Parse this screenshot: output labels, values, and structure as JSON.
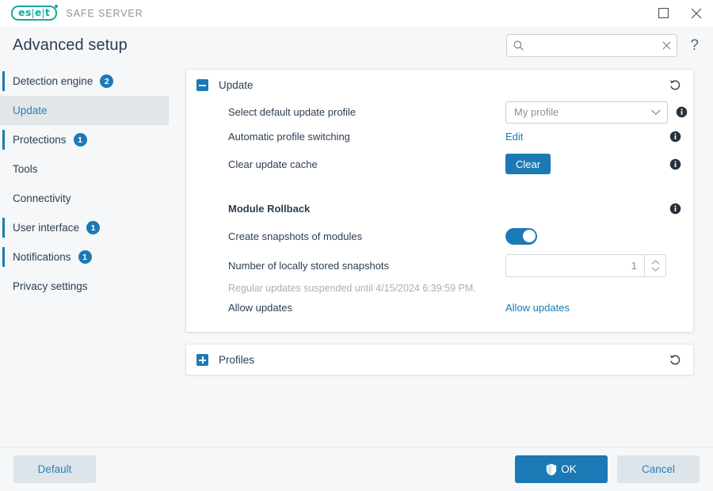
{
  "titlebar": {
    "logo_text_1": "es",
    "logo_text_2": "e",
    "logo_text_3": "t",
    "product_name": "SAFE SERVER",
    "maximize_icon": "maximize-icon",
    "close_icon": "close-icon"
  },
  "header": {
    "title": "Advanced setup",
    "search": {
      "value": "",
      "placeholder": "",
      "icon": "search-icon",
      "clear_icon": "clear-icon"
    },
    "help_label": "?"
  },
  "sidebar": {
    "items": [
      {
        "label": "Detection engine",
        "badge": "2",
        "active": false,
        "accent": true
      },
      {
        "label": "Update",
        "badge": "",
        "active": true,
        "accent": false
      },
      {
        "label": "Protections",
        "badge": "1",
        "active": false,
        "accent": true
      },
      {
        "label": "Tools",
        "badge": "",
        "active": false,
        "accent": false
      },
      {
        "label": "Connectivity",
        "badge": "",
        "active": false,
        "accent": false
      },
      {
        "label": "User interface",
        "badge": "1",
        "active": false,
        "accent": true
      },
      {
        "label": "Notifications",
        "badge": "1",
        "active": false,
        "accent": true
      },
      {
        "label": "Privacy settings",
        "badge": "",
        "active": false,
        "accent": false
      }
    ]
  },
  "update_panel": {
    "title": "Update",
    "expanded": true,
    "revert_icon": "revert-icon",
    "rows": {
      "profile": {
        "label": "Select default update profile",
        "value": "My profile",
        "chevron_icon": "chevron-down-icon",
        "info_icon": "info-icon"
      },
      "auto_switch": {
        "label": "Automatic profile switching",
        "link": "Edit",
        "info_icon": "info-icon"
      },
      "clear_cache": {
        "label": "Clear update cache",
        "button": "Clear",
        "info_icon": "info-icon"
      }
    },
    "module_rollback": {
      "heading": "Module Rollback",
      "info_icon": "info-icon",
      "snapshots": {
        "label": "Create snapshots of modules",
        "toggle_state": "on"
      },
      "stored": {
        "label": "Number of locally stored snapshots",
        "value": "1",
        "up_icon": "chevron-up-icon",
        "down_icon": "chevron-down-icon"
      },
      "note": "Regular updates suspended until 4/15/2024 6:39:59 PM.",
      "allow": {
        "label": "Allow updates",
        "link": "Allow updates"
      }
    }
  },
  "profiles_panel": {
    "title": "Profiles",
    "expanded": false,
    "revert_icon": "revert-icon"
  },
  "footer": {
    "default_label": "Default",
    "ok_label": "OK",
    "ok_icon": "shield-icon",
    "cancel_label": "Cancel"
  },
  "colors": {
    "accent_blue": "#1b7ab5",
    "brand_teal": "#12a9a0",
    "title_navy": "#2b3e52",
    "panel_bg": "#ffffff",
    "app_bg": "#f5f7f8",
    "secondary_btn": "#dde5ea"
  }
}
